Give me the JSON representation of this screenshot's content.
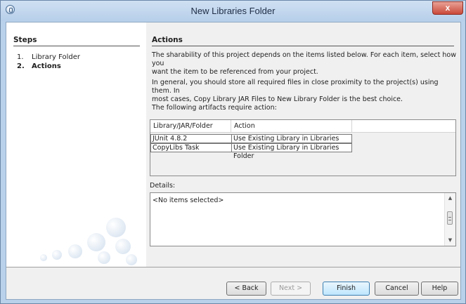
{
  "window": {
    "title": "New Libraries Folder",
    "close_glyph": "x"
  },
  "steps": {
    "title": "Steps",
    "items": [
      {
        "num": "1.",
        "label": "Library Folder"
      },
      {
        "num": "2.",
        "label": "Actions"
      }
    ]
  },
  "actions": {
    "title": "Actions",
    "para1_line1": "The sharability of this project depends on the items listed below. For each item, select how you",
    "para1_line2": "want the item to be referenced from your project.",
    "para2_line1": "In general, you should store all required files in close proximity to the project(s) using them. In",
    "para2_line2": "most cases, Copy Library JAR Files to New Library Folder is the best choice.",
    "artifacts_label": "The following artifacts require action:",
    "table": {
      "headers": [
        "Library/JAR/Folder",
        "Action"
      ],
      "rows": [
        [
          "JUnit 4.8.2",
          "Use Existing Library in Libraries Folder"
        ],
        [
          "CopyLibs Task",
          "Use Existing Library in Libraries Folder"
        ]
      ]
    },
    "details_label": "Details:",
    "details_text": "<No items selected>"
  },
  "buttons": {
    "back": "< Back",
    "next": "Next >",
    "finish": "Finish",
    "cancel": "Cancel",
    "help": "Help"
  }
}
